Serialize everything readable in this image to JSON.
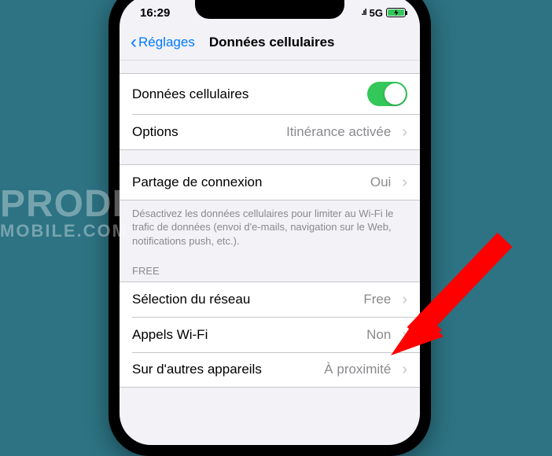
{
  "statusbar": {
    "time": "16:29",
    "network": "5G"
  },
  "nav": {
    "back": "Réglages",
    "title": "Données cellulaires"
  },
  "group1": {
    "cellular": {
      "label": "Données cellulaires",
      "on": true
    },
    "options": {
      "label": "Options",
      "value": "Itinérance activée"
    },
    "hotspot": {
      "label": "Partage de connexion",
      "value": "Oui"
    },
    "footer": "Désactivez les données cellulaires pour limiter au Wi-Fi le trafic de données (envoi d'e-mails, navigation sur le Web, notifications push, etc.)."
  },
  "carrier_header": "FREE",
  "group2": {
    "network": {
      "label": "Sélection du réseau",
      "value": "Free"
    },
    "wifi": {
      "label": "Appels Wi-Fi",
      "value": "Non"
    },
    "other": {
      "label": "Sur d'autres appareils",
      "value": "À proximité"
    }
  },
  "watermark": {
    "line1": "PRODI",
    "line2": "MOBILE.COM"
  }
}
